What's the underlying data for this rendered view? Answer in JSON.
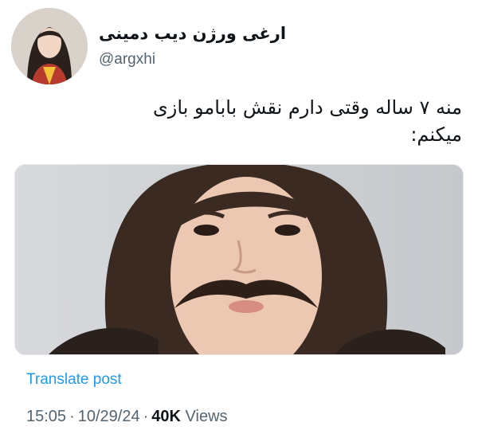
{
  "author": {
    "display_name": "ارغی ورژن دیب دمینی",
    "handle": "@argxhi"
  },
  "tweet": {
    "text_line1": "منه ۷ ساله وقتی دارم نقش بابامو بازی",
    "text_line2": "میکنم:"
  },
  "translate_label": "Translate post",
  "meta": {
    "time": "15:05",
    "date": "10/29/24",
    "views_count": "40K",
    "views_label": "Views",
    "separator": "·"
  },
  "colors": {
    "link": "#1d9bf0",
    "muted": "#536471",
    "text": "#0f1419"
  }
}
